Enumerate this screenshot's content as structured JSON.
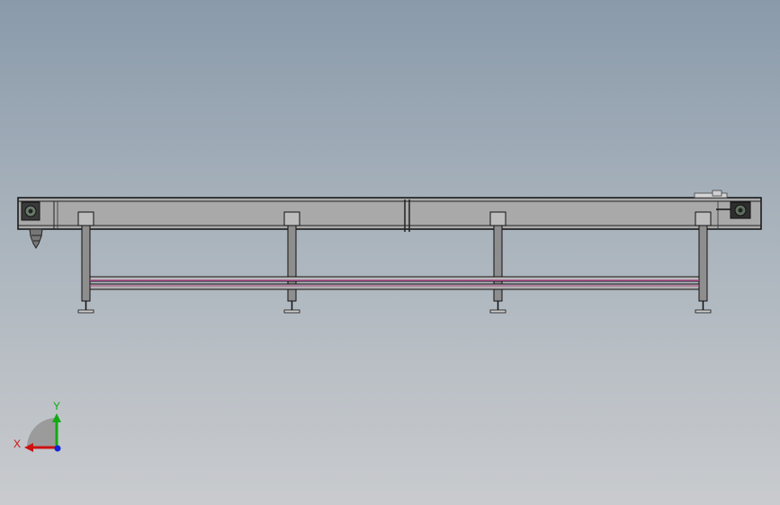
{
  "viewport": {
    "background_top": "#8a9aab",
    "background_bottom": "#c9cbce"
  },
  "model": {
    "frame_color": "#a7a7a7",
    "frame_stroke": "#111111",
    "leg_color": "#8c8c8c",
    "rail_accent_color": "#b04a8c",
    "leg_count": 4,
    "motor_icons": [
      "motor-drive-left-icon",
      "motor-drive-right-icon"
    ]
  },
  "triad": {
    "x_label": "X",
    "y_label": "Y",
    "x_color": "#cc1111",
    "y_color": "#11aa11",
    "z_color": "#1122dd"
  }
}
